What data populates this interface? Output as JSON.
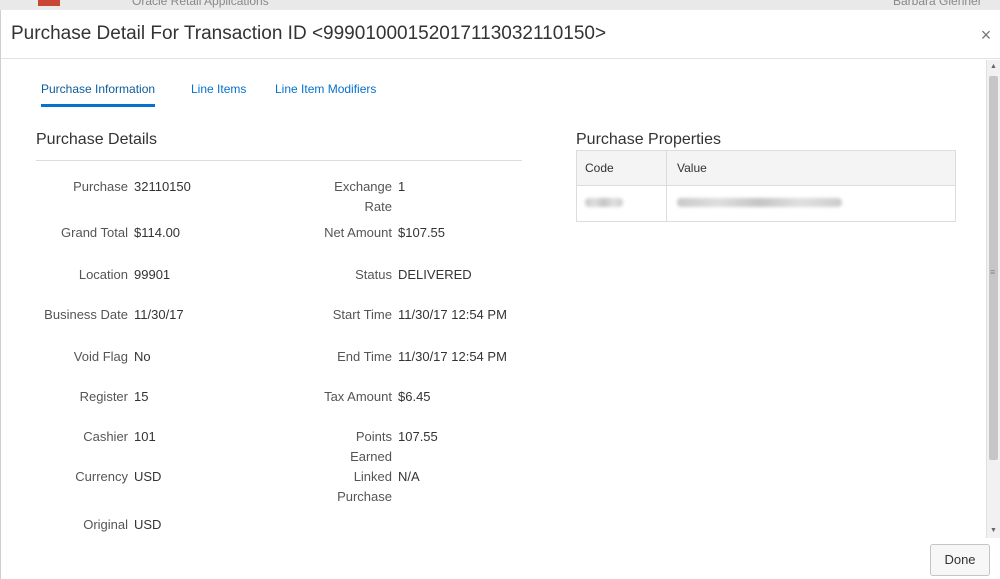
{
  "background": {
    "app_title": "Oracle Retail Applications",
    "user": "Barbara Glenner"
  },
  "dialog": {
    "title": "Purchase Detail For Transaction ID <99901000152017113032110150>",
    "close_symbol": "×",
    "done_label": "Done"
  },
  "tabs": [
    {
      "label": "Purchase Information",
      "active": true
    },
    {
      "label": "Line Items",
      "active": false
    },
    {
      "label": "Line Item Modifiers",
      "active": false
    }
  ],
  "purchase_details": {
    "title": "Purchase Details",
    "left_fields": [
      {
        "label": "Purchase",
        "value": "32110150"
      },
      {
        "label": "Grand Total",
        "value": "$114.00"
      },
      {
        "label": "Location",
        "value": "99901"
      },
      {
        "label": "Business Date",
        "value": "11/30/17"
      },
      {
        "label": "Void Flag",
        "value": "No"
      },
      {
        "label": "Register",
        "value": "15"
      },
      {
        "label": "Cashier",
        "value": "101"
      },
      {
        "label": "Currency",
        "value": "USD"
      },
      {
        "label": "Original",
        "value": "USD"
      }
    ],
    "right_fields": [
      {
        "label_line1": "Exchange",
        "label_line2": "Rate",
        "value": "1"
      },
      {
        "label_line1": "Net Amount",
        "label_line2": "",
        "value": "$107.55"
      },
      {
        "label_line1": "Status",
        "label_line2": "",
        "value": "DELIVERED"
      },
      {
        "label_line1": "Start Time",
        "label_line2": "",
        "value": "11/30/17 12:54 PM"
      },
      {
        "label_line1": "End Time",
        "label_line2": "",
        "value": "11/30/17 12:54 PM"
      },
      {
        "label_line1": "Tax Amount",
        "label_line2": "",
        "value": "$6.45"
      },
      {
        "label_line1": "Points",
        "label_line2": "Earned",
        "value": "107.55"
      },
      {
        "label_line1": "Linked",
        "label_line2": "Purchase",
        "value": "N/A"
      }
    ]
  },
  "purchase_properties": {
    "title": "Purchase Properties",
    "columns": [
      "Code",
      "Value"
    ]
  }
}
